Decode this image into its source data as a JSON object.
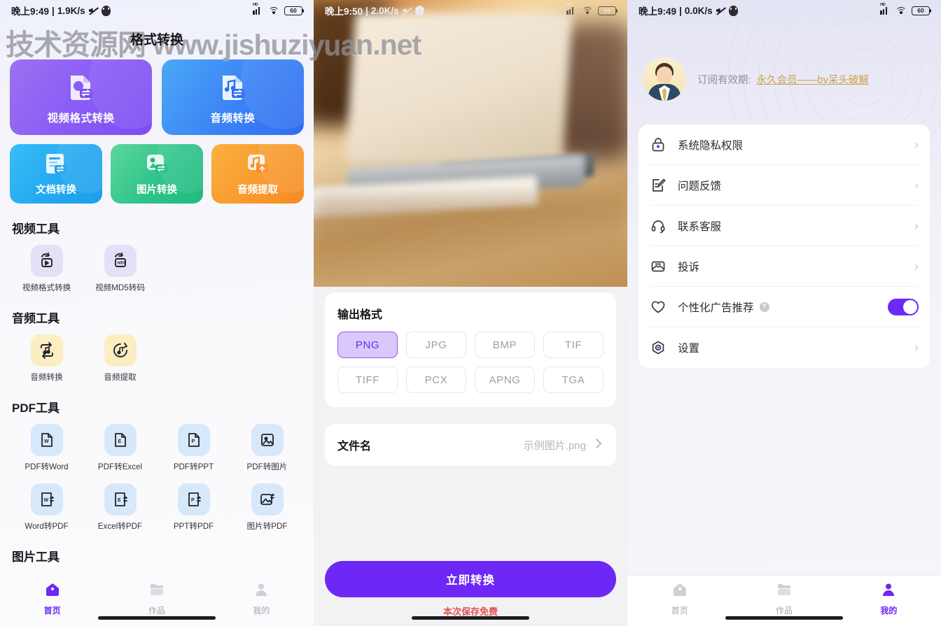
{
  "watermark": "技术资源网 www.jishuziyuan.net",
  "screen1": {
    "statusbar": {
      "time": "晚上9:49",
      "sep": "|",
      "speed": "1.9K/s",
      "battery": "60",
      "mute_icon": "mute-icon",
      "qq_icon": "qq-icon",
      "signal_icon": "signal-icon",
      "wifi_icon": "wifi-icon",
      "battery_icon": "battery-icon"
    },
    "title": "格式转换",
    "big_cards": [
      {
        "label": "视频格式转换",
        "icon": "video-convert-icon"
      },
      {
        "label": "音频转换",
        "icon": "audio-convert-icon"
      }
    ],
    "small_cards": [
      {
        "label": "文档转换",
        "icon": "document-convert-icon"
      },
      {
        "label": "图片转换",
        "icon": "image-convert-icon"
      },
      {
        "label": "音频提取",
        "icon": "audio-extract-icon"
      }
    ],
    "sections": [
      {
        "title": "视频工具",
        "tools": [
          {
            "label": "视频格式转换",
            "icon": "video-format-icon"
          },
          {
            "label": "视频MD5转码",
            "icon": "video-md5-icon"
          }
        ]
      },
      {
        "title": "音频工具",
        "tools": [
          {
            "label": "音频转换",
            "icon": "audio-loop-icon"
          },
          {
            "label": "音频提取",
            "icon": "audio-note-icon"
          }
        ]
      },
      {
        "title": "PDF工具",
        "tools": [
          {
            "label": "PDF转Word",
            "icon": "pdf-to-word-icon"
          },
          {
            "label": "PDF转Excel",
            "icon": "pdf-to-excel-icon"
          },
          {
            "label": "PDF转PPT",
            "icon": "pdf-to-ppt-icon"
          },
          {
            "label": "PDF转图片",
            "icon": "pdf-to-image-icon"
          },
          {
            "label": "Word转PDF",
            "icon": "word-to-pdf-icon"
          },
          {
            "label": "Excel转PDF",
            "icon": "excel-to-pdf-icon"
          },
          {
            "label": "PPT转PDF",
            "icon": "ppt-to-pdf-icon"
          },
          {
            "label": "图片转PDF",
            "icon": "image-to-pdf-icon"
          }
        ]
      },
      {
        "title": "图片工具",
        "tools": []
      }
    ],
    "nav": [
      {
        "label": "首页",
        "icon": "home-icon",
        "active": true
      },
      {
        "label": "作品",
        "icon": "folder-icon",
        "active": false
      },
      {
        "label": "我的",
        "icon": "person-icon",
        "active": false
      }
    ]
  },
  "screen2": {
    "statusbar": {
      "time": "晚上9:50",
      "sep": "|",
      "speed": "2.0K/s",
      "battery": "69"
    },
    "output_format": {
      "title": "输出格式",
      "options": [
        "PNG",
        "JPG",
        "BMP",
        "TIF",
        "TIFF",
        "PCX",
        "APNG",
        "TGA"
      ],
      "selected": "PNG"
    },
    "filename": {
      "label": "文件名",
      "value": "示例图片.png",
      "chevron": "chevron-right-icon"
    },
    "convert_button": "立即转换",
    "free_note": "本次保存免费"
  },
  "screen3": {
    "statusbar": {
      "time": "晚上9:49",
      "sep": "|",
      "speed": "0.0K/s",
      "battery": "60"
    },
    "profile": {
      "sub_label": "订阅有效期:",
      "sub_value": "永久会员——by呆头破解",
      "avatar": "avatar"
    },
    "menu": [
      {
        "label": "系统隐私权限",
        "icon": "lock-icon",
        "type": "chevron"
      },
      {
        "label": "问题反馈",
        "icon": "feedback-icon",
        "type": "chevron"
      },
      {
        "label": "联系客服",
        "icon": "headset-icon",
        "type": "chevron"
      },
      {
        "label": "投诉",
        "icon": "mail-icon",
        "type": "chevron"
      },
      {
        "label": "个性化广告推荐",
        "icon": "heart-icon",
        "type": "toggle",
        "toggle_on": true,
        "help": "?"
      },
      {
        "label": "设置",
        "icon": "settings-icon",
        "type": "chevron"
      }
    ],
    "nav": [
      {
        "label": "首页",
        "icon": "home-icon",
        "active": false
      },
      {
        "label": "作品",
        "icon": "folder-icon",
        "active": false
      },
      {
        "label": "我的",
        "icon": "person-icon",
        "active": true
      }
    ]
  },
  "colors": {
    "accent": "#6d28f5",
    "selected_bg": "#d9c9fa",
    "free_note": "#e05252",
    "gold": "#c9a24a"
  }
}
